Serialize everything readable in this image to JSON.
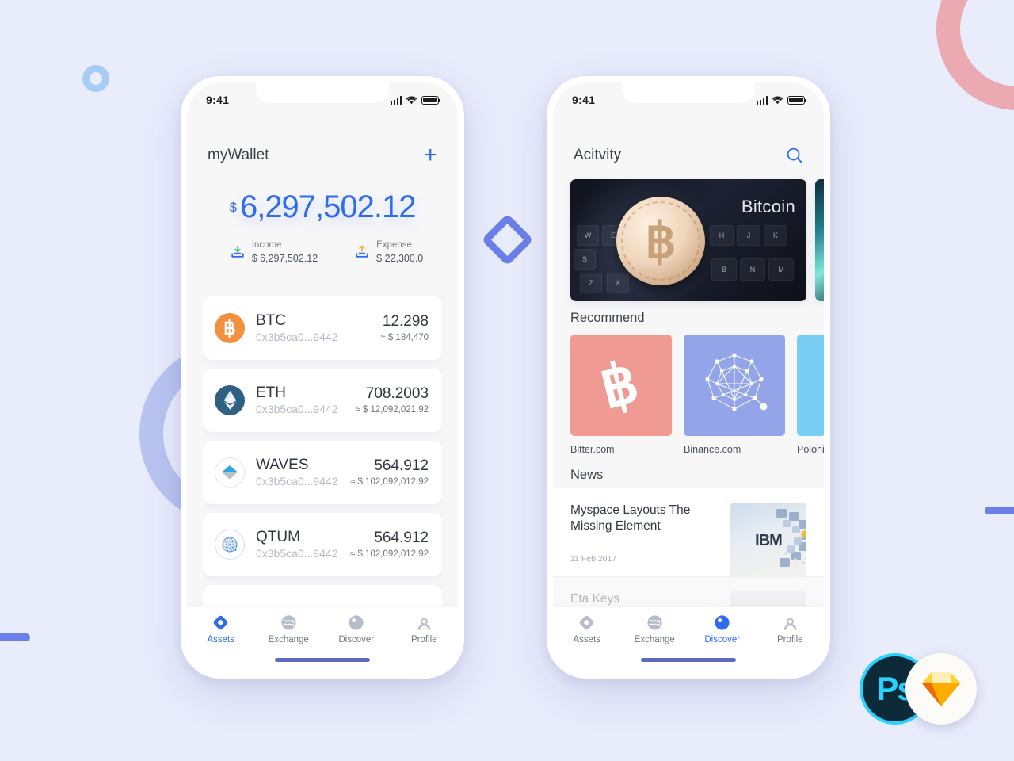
{
  "background": {
    "color": "#e8ecfb",
    "shapes": [
      {
        "name": "ring-small",
        "color": "#a8cdf4"
      },
      {
        "name": "ring-large-left",
        "color": "#b9c4f0"
      },
      {
        "name": "ring-pink",
        "color": "#eba9b2"
      },
      {
        "name": "diamond-shape",
        "color": "#6b7fe8"
      },
      {
        "name": "bar-left",
        "color": "#6b7fe8"
      },
      {
        "name": "bar-right",
        "color": "#6b7fe8"
      }
    ]
  },
  "badges": {
    "photoshop_label": "Ps",
    "sketch_label": "sketch-diamond-icon"
  },
  "accent": {
    "blue": "#2f6bf0",
    "inactive": "#6e737d",
    "btc_orange": "#f2903f",
    "eth_blue": "#2f5f82"
  },
  "phone_wallet": {
    "status": {
      "time": "9:41"
    },
    "header": {
      "title": "myWallet",
      "add_label": "+"
    },
    "balance": {
      "currency_symbol": "$",
      "amount": "6,297,502.12",
      "income_label": "Income",
      "income_value": "$ 6,297,502.12",
      "expense_label": "Expense",
      "expense_value": "$ 22,300.0"
    },
    "assets": [
      {
        "symbol": "BTC",
        "address": "0x3b5ca0...9442",
        "amount": "12.298",
        "fiat": "≈ $ 184,470"
      },
      {
        "symbol": "ETH",
        "address": "0x3b5ca0...9442",
        "amount": "708.2003",
        "fiat": "≈ $ 12,092,021.92"
      },
      {
        "symbol": "WAVES",
        "address": "0x3b5ca0...9442",
        "amount": "564.912",
        "fiat": "≈ $ 102,092,012.92"
      },
      {
        "symbol": "QTUM",
        "address": "0x3b5ca0...9442",
        "amount": "564.912",
        "fiat": "≈ $ 102,092,012.92"
      }
    ],
    "tabs": [
      {
        "label": "Assets",
        "icon": "diamond-icon",
        "active": true
      },
      {
        "label": "Exchange",
        "icon": "exchange-icon",
        "active": false
      },
      {
        "label": "Discover",
        "icon": "compass-icon",
        "active": false
      },
      {
        "label": "Profile",
        "icon": "person-icon",
        "active": false
      }
    ]
  },
  "phone_discover": {
    "status": {
      "time": "9:41"
    },
    "header": {
      "title": "Acitvity",
      "search_icon": "search-icon"
    },
    "banner": {
      "caption": "Bitcoin"
    },
    "sections": {
      "recommend": "Recommend",
      "news": "News"
    },
    "recommend": [
      {
        "name": "Bitter.com",
        "bg": "#f09a94",
        "icon": "bitcoin-icon"
      },
      {
        "name": "Binance.com",
        "bg": "#93a5e8",
        "icon": "network-graph-icon"
      },
      {
        "name": "Polonie",
        "bg": "#77cef2",
        "icon": "poloniex-icon"
      }
    ],
    "news": [
      {
        "title": "Myspace Layouts The Missing Element",
        "date": "11 Feb 2017",
        "thumb": "ibm-photo"
      },
      {
        "title": "Eta Keys",
        "date": "",
        "thumb": "avatar-photo"
      }
    ],
    "tabs": [
      {
        "label": "Assets",
        "icon": "diamond-icon",
        "active": false
      },
      {
        "label": "Exchange",
        "icon": "exchange-icon",
        "active": false
      },
      {
        "label": "Discover",
        "icon": "compass-icon",
        "active": true
      },
      {
        "label": "Profile",
        "icon": "person-icon",
        "active": false
      }
    ]
  }
}
